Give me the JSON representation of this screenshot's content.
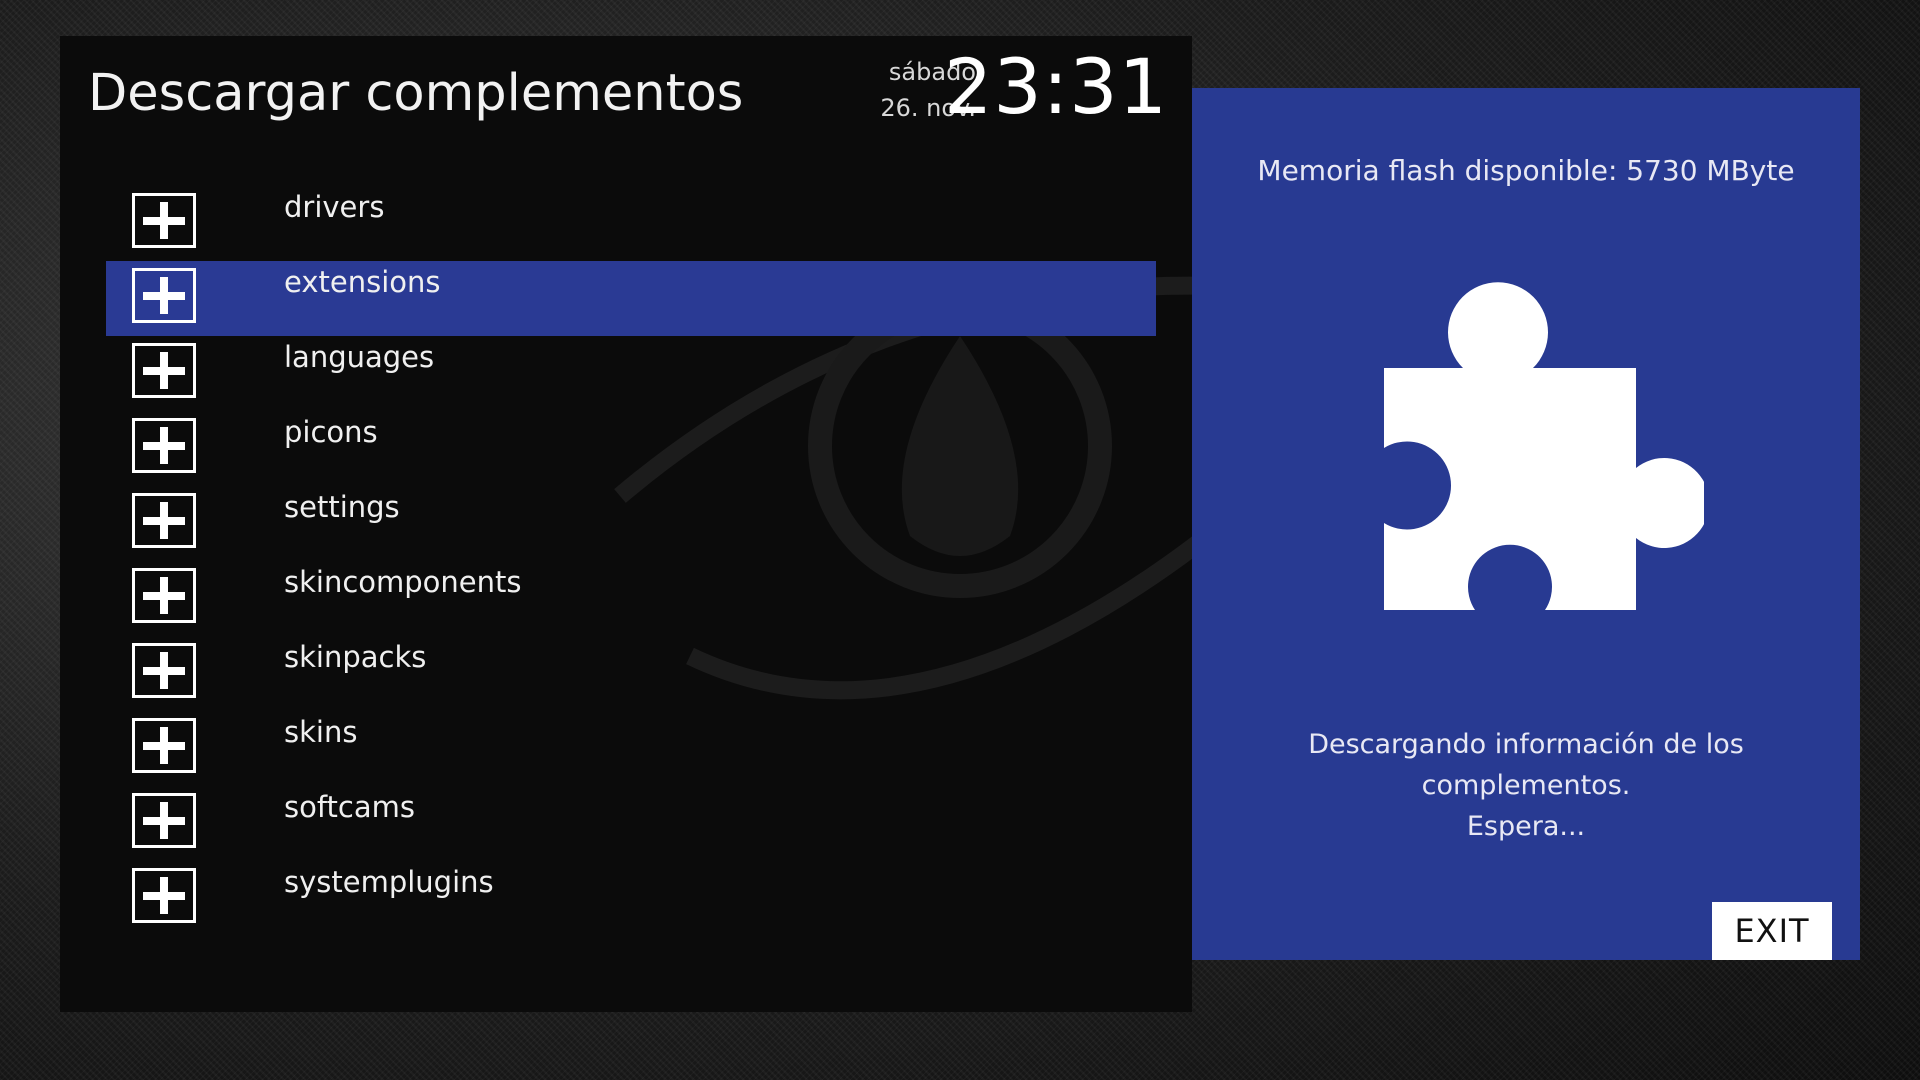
{
  "header": {
    "title": "Descargar complementos",
    "day": "sábado",
    "date": "26. nov.",
    "time": "23:31"
  },
  "list": {
    "items": [
      {
        "label": "drivers",
        "icon": "plus-icon"
      },
      {
        "label": "extensions",
        "icon": "plus-icon",
        "selected": true
      },
      {
        "label": "languages",
        "icon": "plus-icon"
      },
      {
        "label": "picons",
        "icon": "plus-icon"
      },
      {
        "label": "settings",
        "icon": "plus-icon"
      },
      {
        "label": "skincomponents",
        "icon": "plus-icon"
      },
      {
        "label": "skinpacks",
        "icon": "plus-icon"
      },
      {
        "label": "skins",
        "icon": "plus-icon"
      },
      {
        "label": "softcams",
        "icon": "plus-icon"
      },
      {
        "label": "systemplugins",
        "icon": "plus-icon"
      }
    ]
  },
  "info_panel": {
    "memory": "Memoria flash disponible: 5730 MByte",
    "icon": "puzzle-piece-icon",
    "status_line1": "Descargando información de los complementos.",
    "status_line2": "Espera...",
    "exit_label": "EXIT"
  },
  "colors": {
    "selection": "#2a3a94",
    "info_panel": "#283a92",
    "panel_background": "#0b0b0b"
  }
}
